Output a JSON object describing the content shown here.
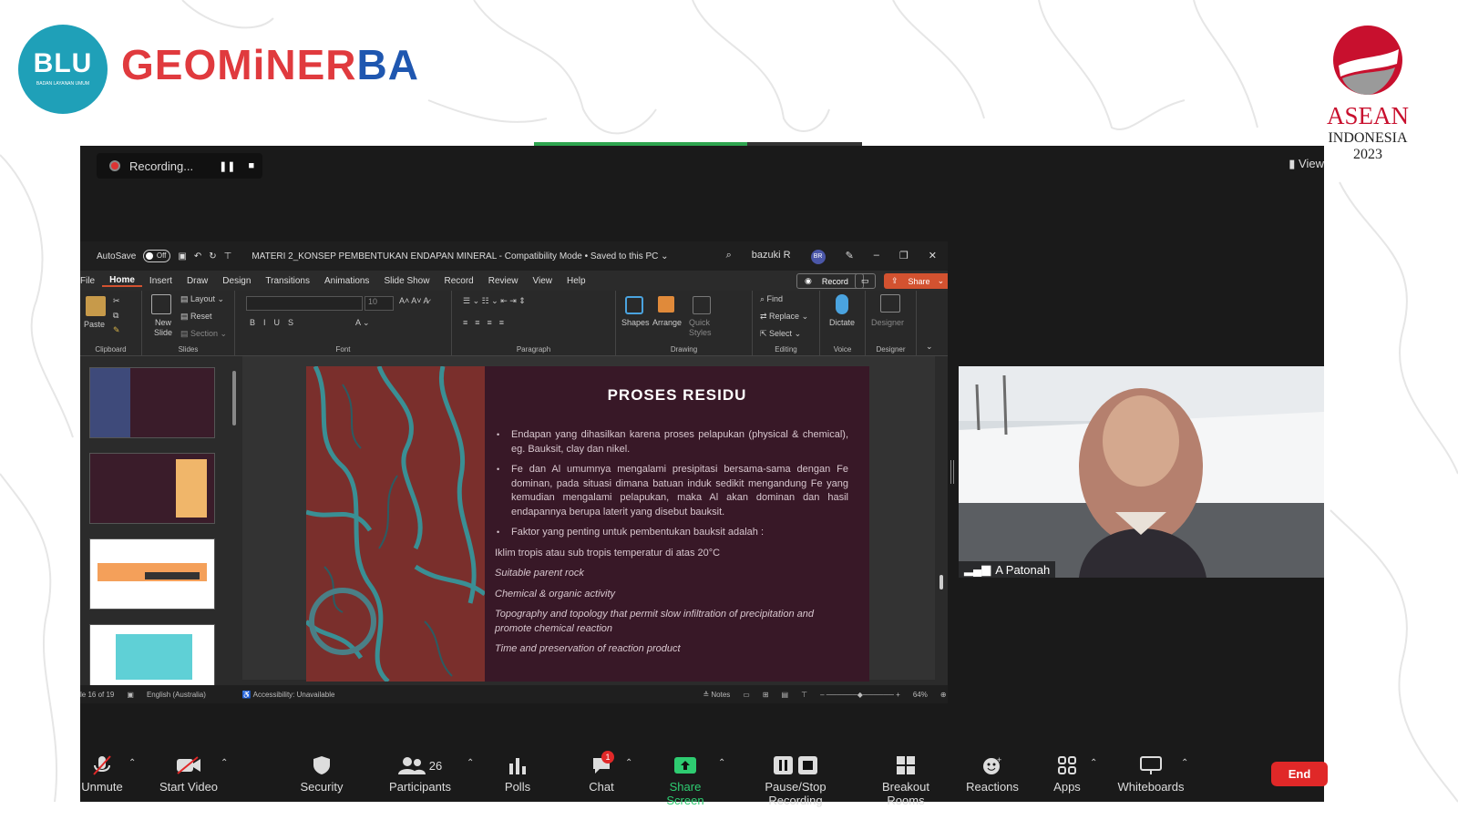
{
  "branding": {
    "blu_title": "BLU",
    "blu_sub": "BADAN LAYANAN UMUM",
    "geo_part1": "GEOM",
    "geo_part2": "i",
    "geo_part3": "NER",
    "geo_part4": "BA",
    "asean_title": "ASEAN",
    "asean_country": "INDONESIA",
    "asean_year": "2023"
  },
  "colors": {
    "geo_red": "#e03a3e",
    "geo_blue": "#1f57b0",
    "zoom_bg": "#1a1a1a",
    "end_red": "#e02828",
    "share_green": "#2ecc71",
    "accent": "#d35230"
  },
  "zoom": {
    "recording_label": "Recording...",
    "view_label": "View"
  },
  "ppt": {
    "autosave": "AutoSave",
    "autosave_state": "Off",
    "file_title": "MATERI 2_KONSEP PEMBENTUKAN ENDAPAN MINERAL  -  Compatibility Mode  •  Saved to this PC ⌄",
    "user_name": "bazuki R",
    "user_initials": "BR",
    "tabs": [
      "File",
      "Home",
      "Insert",
      "Draw",
      "Design",
      "Transitions",
      "Animations",
      "Slide Show",
      "Record",
      "Review",
      "View",
      "Help"
    ],
    "record_btn": "Record",
    "share_btn": "Share",
    "groups": {
      "clipboard": "Clipboard",
      "slides": "Slides",
      "font": "Font",
      "paragraph": "Paragraph",
      "drawing": "Drawing",
      "editing": "Editing",
      "voice": "Voice",
      "designer": "Designer"
    },
    "ribbon": {
      "paste": "Paste",
      "new_slide": "New Slide",
      "layout": "Layout",
      "reset": "Reset",
      "section": "Section",
      "font_size": "10",
      "shapes": "Shapes",
      "arrange": "Arrange",
      "quick_styles": "Quick Styles",
      "find": "Find",
      "replace": "Replace",
      "select": "Select",
      "dictate": "Dictate",
      "designer": "Designer"
    },
    "slide": {
      "title": "PROSES RESIDU",
      "bullets": [
        "Endapan yang dihasilkan karena proses pelapukan (physical & chemical), eg. Bauksit, clay dan nikel.",
        "Fe dan Al umumnya mengalami presipitasi bersama-sama dengan Fe dominan, pada situasi dimana batuan induk sedikit mengandung Fe yang kemudian mengalami pelapukan, maka Al akan dominan dan hasil endapannya berupa laterit yang disebut bauksit.",
        "Faktor yang penting untuk pembentukan bauksit adalah :"
      ],
      "factors": [
        "Iklim tropis atau  sub tropis temperatur di atas 20°C",
        "Suitable parent rock",
        "Chemical & organic activity",
        "Topography and topology that permit slow infiltration of precipitation and promote chemical reaction",
        "Time and preservation of reaction product"
      ]
    },
    "status": {
      "slide_count": "le 16 of 19",
      "language": "English (Australia)",
      "accessibility": "Accessibility: Unavailable",
      "notes": "Notes",
      "zoom": "64%"
    }
  },
  "participant": {
    "name": "A Patonah"
  },
  "toolbar": {
    "unmute": "Unmute",
    "start_video": "Start Video",
    "security": "Security",
    "participants": "Participants",
    "participant_count": "26",
    "polls": "Polls",
    "chat": "Chat",
    "chat_badge": "1",
    "share_screen": "Share Screen",
    "pause_stop": "Pause/Stop Recording",
    "breakout": "Breakout Rooms",
    "reactions": "Reactions",
    "apps": "Apps",
    "whiteboards": "Whiteboards",
    "end": "End"
  }
}
